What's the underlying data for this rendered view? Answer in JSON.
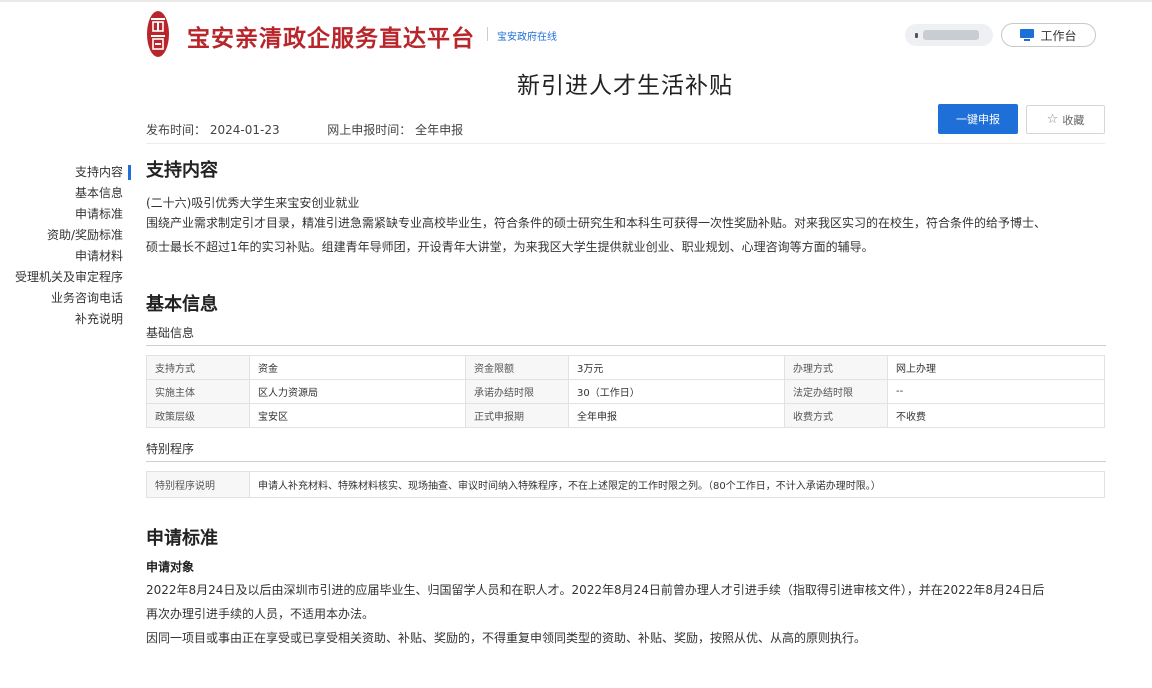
{
  "header": {
    "site_title": "宝安亲清政企服务直达平台",
    "gov_link": "宝安政府在线",
    "workbench_label": "工作台",
    "brand_color": "#b8252b",
    "accent_color": "#1f6fd8"
  },
  "page": {
    "title": "新引进人才生活补贴",
    "publish_label": "发布时间：",
    "publish_date": "2024-01-23",
    "online_label": "网上申报时间：",
    "online_value": "全年申报",
    "apply_button": "一键申报",
    "favorite_button": "收藏"
  },
  "sidenav": {
    "items": [
      {
        "label": "支持内容",
        "active": true
      },
      {
        "label": "基本信息"
      },
      {
        "label": "申请标准"
      },
      {
        "label": "资助/奖励标准"
      },
      {
        "label": "申请材料"
      },
      {
        "label": "受理机关及审定程序"
      },
      {
        "label": "业务咨询电话"
      },
      {
        "label": "补充说明"
      }
    ]
  },
  "support": {
    "title": "支持内容",
    "line1": "(二十六)吸引优秀大学生来宝安创业就业",
    "line2": "围绕产业需求制定引才目录，精准引进急需紧缺专业高校毕业生，符合条件的硕士研究生和本科生可获得一次性奖励补贴。对来我区实习的在校生，符合条件的给予博士、",
    "line3": "硕士最长不超过1年的实习补贴。组建青年导师团，开设青年大讲堂，为来我区大学生提供就业创业、职业规划、心理咨询等方面的辅导。"
  },
  "basic": {
    "title": "基本信息",
    "subtitle": "基础信息",
    "rows": [
      [
        "支持方式",
        "资金",
        "资金限额",
        "3万元",
        "办理方式",
        "网上办理"
      ],
      [
        "实施主体",
        "区人力资源局",
        "承诺办结时限",
        "30（工作日）",
        "法定办结时限",
        "--"
      ],
      [
        "政策层级",
        "宝安区",
        "正式申报期",
        "全年申报",
        "收费方式",
        "不收费"
      ]
    ],
    "special_title": "特别程序",
    "special_label": "特别程序说明",
    "special_value": "申请人补充材料、特殊材料核实、现场抽查、审议时间纳入特殊程序，不在上述限定的工作时限之列。（80个工作日，不计入承诺办理时限。）"
  },
  "criteria": {
    "title": "申请标准",
    "target_label": "申请对象",
    "p1": "2022年8月24日及以后由深圳市引进的应届毕业生、归国留学人员和在职人才。2022年8月24日前曾办理人才引进手续（指取得引进审核文件），并在2022年8月24日后",
    "p2": "再次办理引进手续的人员，不适用本办法。",
    "p3": "因同一项目或事由正在享受或已享受相关资助、补贴、奖励的，不得重复申领同类型的资助、补贴、奖励，按照从优、从高的原则执行。"
  }
}
